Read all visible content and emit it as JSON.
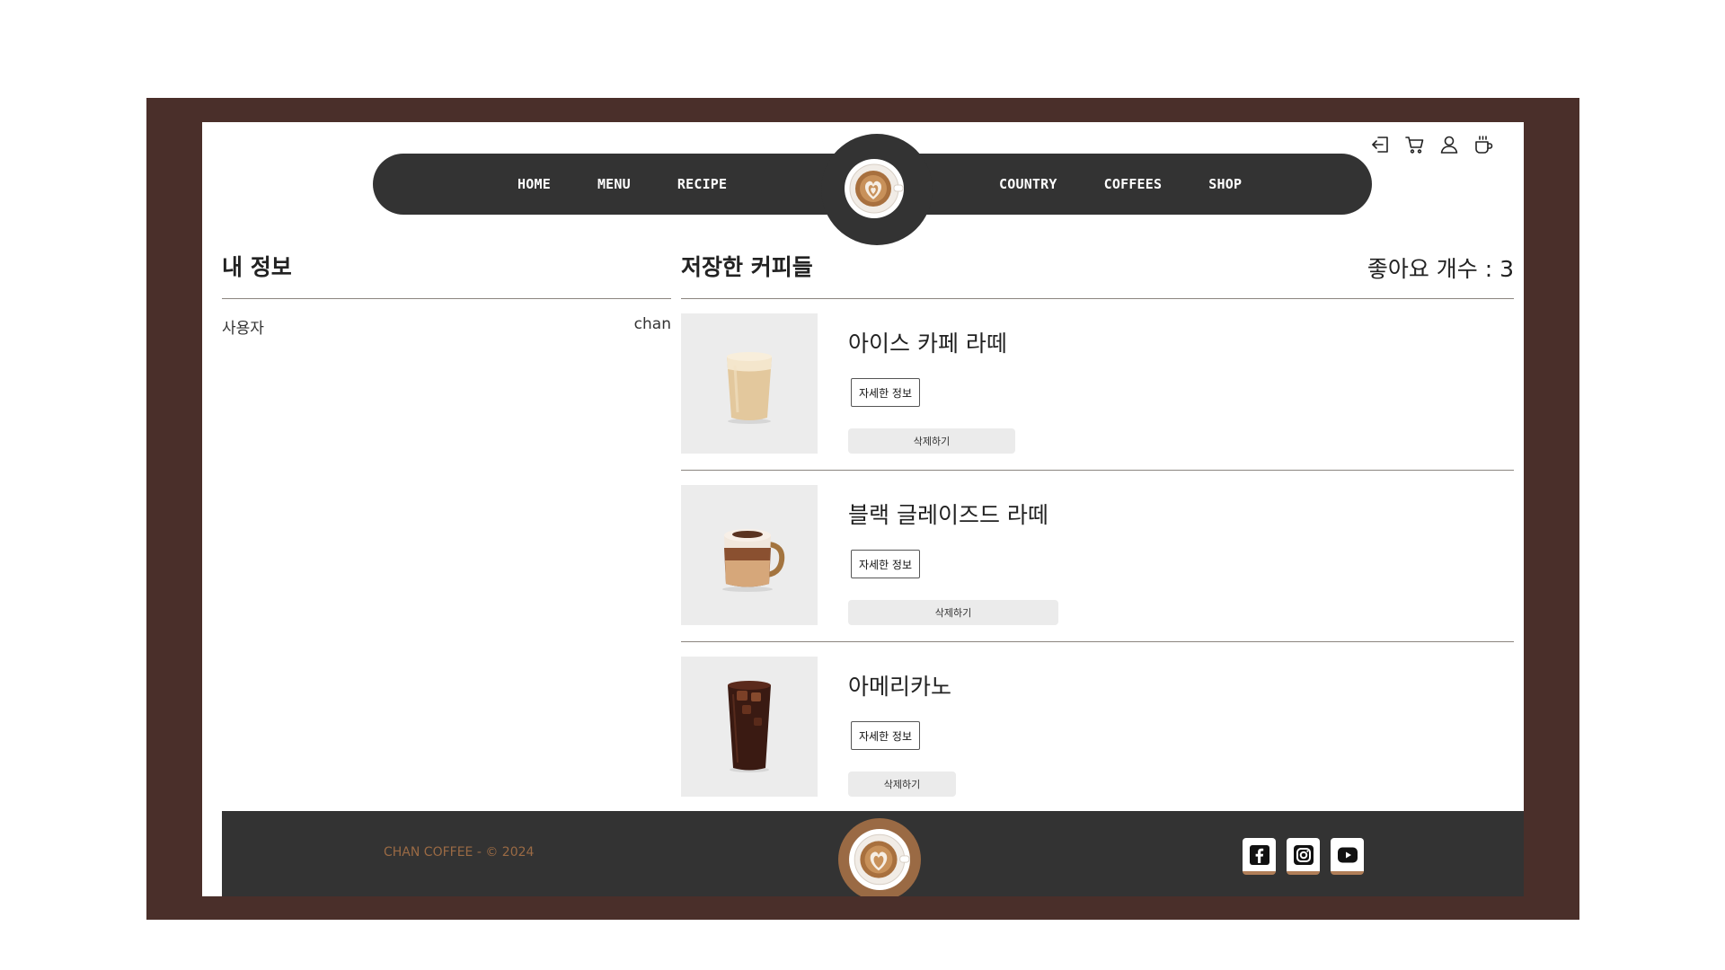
{
  "header": {
    "icons": [
      "login-icon",
      "cart-icon",
      "user-icon",
      "coffee-cup-icon"
    ]
  },
  "nav": {
    "left": [
      "HOME",
      "MENU",
      "RECIPE"
    ],
    "right": [
      "COUNTRY",
      "COFFEES",
      "SHOP"
    ]
  },
  "profile": {
    "title": "내 정보",
    "user_label": "사용자",
    "user_value": "chan"
  },
  "saved": {
    "title": "저장한 커피들",
    "like_count": "좋아요 개수 : 3",
    "items": [
      {
        "name": "아이스 카페 라떼",
        "detail_label": "자세한 정보",
        "delete_label": "삭제하기"
      },
      {
        "name": "블랙 글레이즈드 라떼",
        "detail_label": "자세한 정보",
        "delete_label": "삭제하기"
      },
      {
        "name": "아메리카노",
        "detail_label": "자세한 정보",
        "delete_label": "삭제하기"
      }
    ]
  },
  "footer": {
    "copyright": "CHAN COFFEE - © 2024",
    "socials": [
      "facebook-icon",
      "instagram-icon",
      "youtube-icon"
    ]
  },
  "colors": {
    "frame": "#4a2f2a",
    "nav": "#333333",
    "accent": "#9a6a44"
  }
}
